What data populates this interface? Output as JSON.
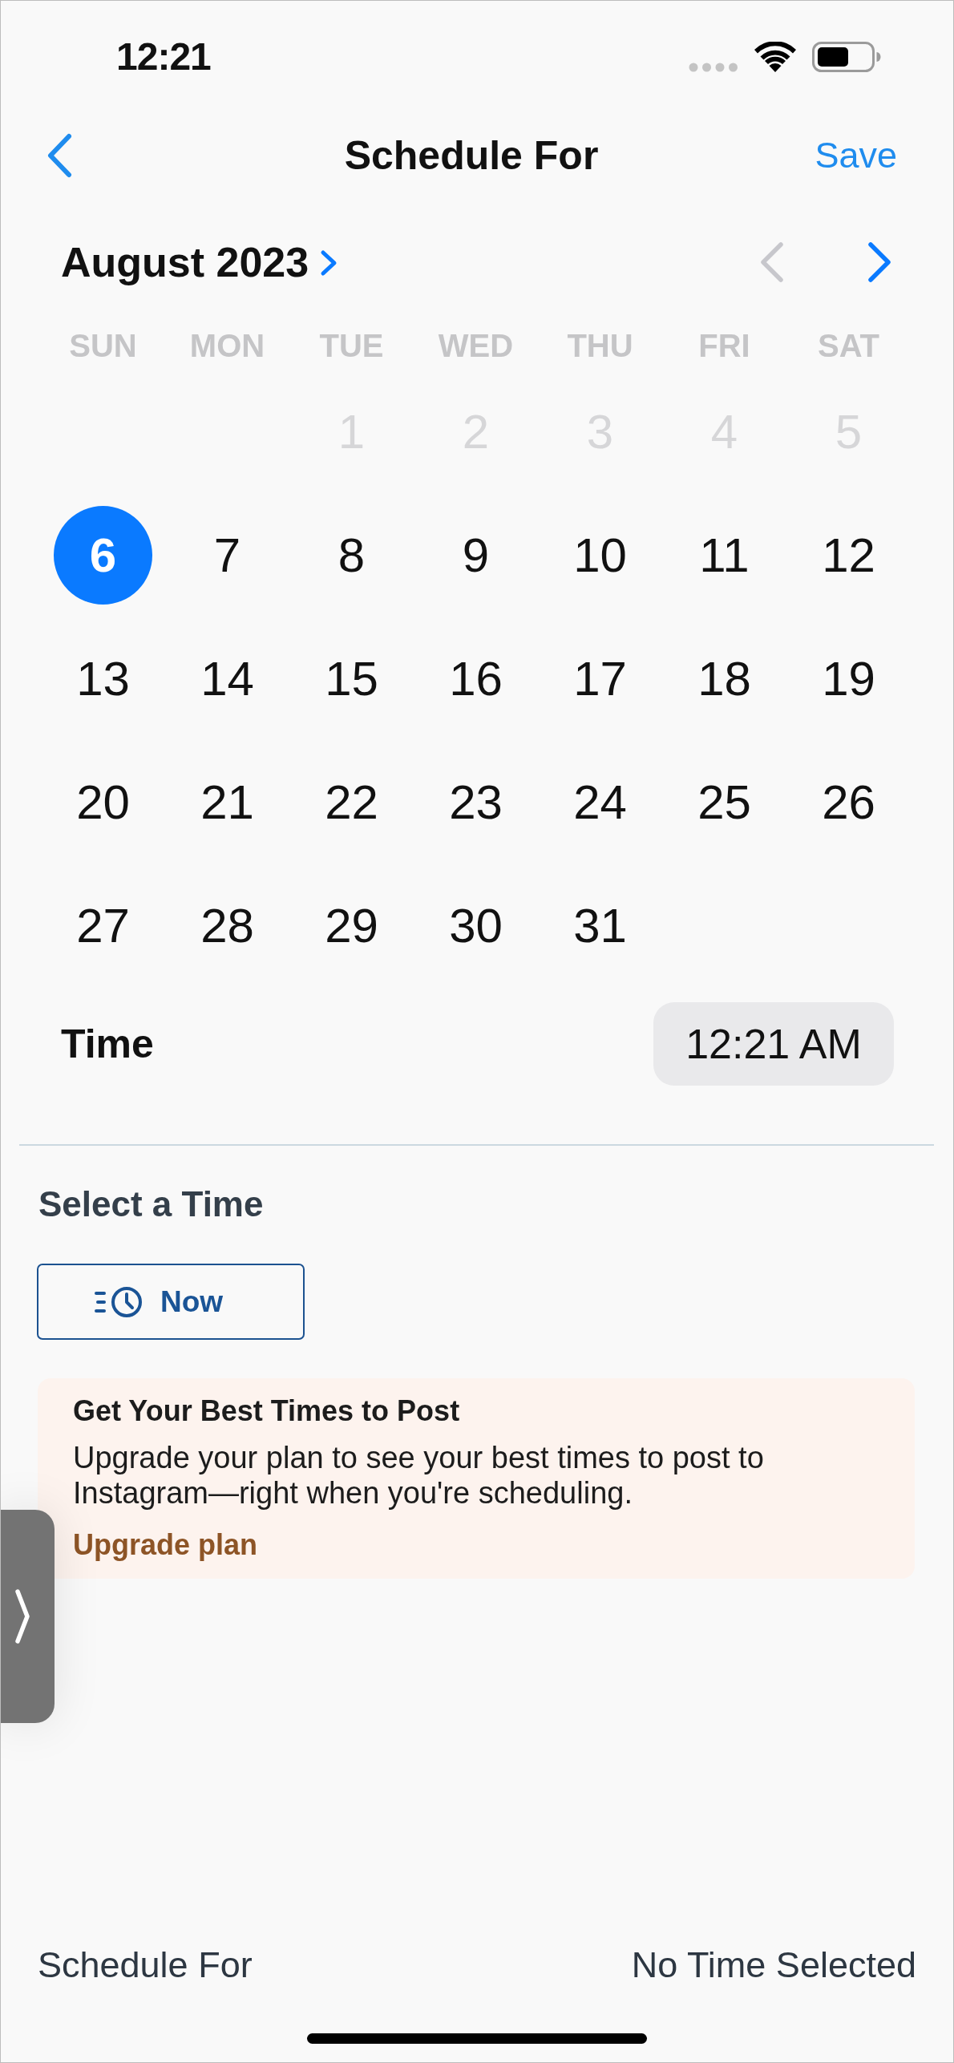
{
  "status_bar": {
    "time": "12:21"
  },
  "nav": {
    "title": "Schedule For",
    "action": "Save"
  },
  "calendar": {
    "month": "August 2023",
    "paging": [
      {
        "kind": "prev",
        "disabled": true
      },
      {
        "kind": "next",
        "disabled": false
      }
    ],
    "weekdays": [
      "SUN",
      "MON",
      "TUE",
      "WED",
      "THU",
      "FRI",
      "SAT"
    ],
    "weeks": [
      [
        {
          "label": "1",
          "disabled": true,
          "selected": false
        },
        {
          "label": "2",
          "disabled": true,
          "selected": false
        },
        {
          "label": "3",
          "disabled": true,
          "selected": false
        },
        {
          "label": "4",
          "disabled": true,
          "selected": false
        },
        {
          "label": "5",
          "disabled": true,
          "selected": false
        }
      ],
      [
        {
          "label": "6",
          "disabled": false,
          "selected": true
        },
        {
          "label": "7",
          "disabled": false,
          "selected": false
        },
        {
          "label": "8",
          "disabled": false,
          "selected": false
        },
        {
          "label": "9",
          "disabled": false,
          "selected": false
        },
        {
          "label": "10",
          "disabled": false,
          "selected": false
        },
        {
          "label": "11",
          "disabled": false,
          "selected": false
        },
        {
          "label": "12",
          "disabled": false,
          "selected": false
        }
      ],
      [
        {
          "label": "13",
          "disabled": false,
          "selected": false
        },
        {
          "label": "14",
          "disabled": false,
          "selected": false
        },
        {
          "label": "15",
          "disabled": false,
          "selected": false
        },
        {
          "label": "16",
          "disabled": false,
          "selected": false
        },
        {
          "label": "17",
          "disabled": false,
          "selected": false
        },
        {
          "label": "18",
          "disabled": false,
          "selected": false
        },
        {
          "label": "19",
          "disabled": false,
          "selected": false
        }
      ],
      [
        {
          "label": "20",
          "disabled": false,
          "selected": false
        },
        {
          "label": "21",
          "disabled": false,
          "selected": false
        },
        {
          "label": "22",
          "disabled": false,
          "selected": false
        },
        {
          "label": "23",
          "disabled": false,
          "selected": false
        },
        {
          "label": "24",
          "disabled": false,
          "selected": false
        },
        {
          "label": "25",
          "disabled": false,
          "selected": false
        },
        {
          "label": "26",
          "disabled": false,
          "selected": false
        }
      ],
      [
        {
          "label": "27",
          "disabled": false,
          "selected": false
        },
        {
          "label": "28",
          "disabled": false,
          "selected": false
        },
        {
          "label": "29",
          "disabled": false,
          "selected": false
        },
        {
          "label": "30",
          "disabled": false,
          "selected": false
        },
        {
          "label": "31",
          "disabled": false,
          "selected": false
        }
      ]
    ]
  },
  "time": {
    "label": "Time",
    "value": "12:21 AM"
  },
  "select_time": {
    "heading": "Select a Time",
    "button": "Now"
  },
  "upsell": {
    "title": "Get Your Best Times to Post",
    "body": "Upgrade your plan to see your best times to post to Instagram—right when you're scheduling.",
    "link": "Upgrade plan"
  },
  "footer": {
    "label": "Schedule For",
    "value": "No Time Selected"
  }
}
